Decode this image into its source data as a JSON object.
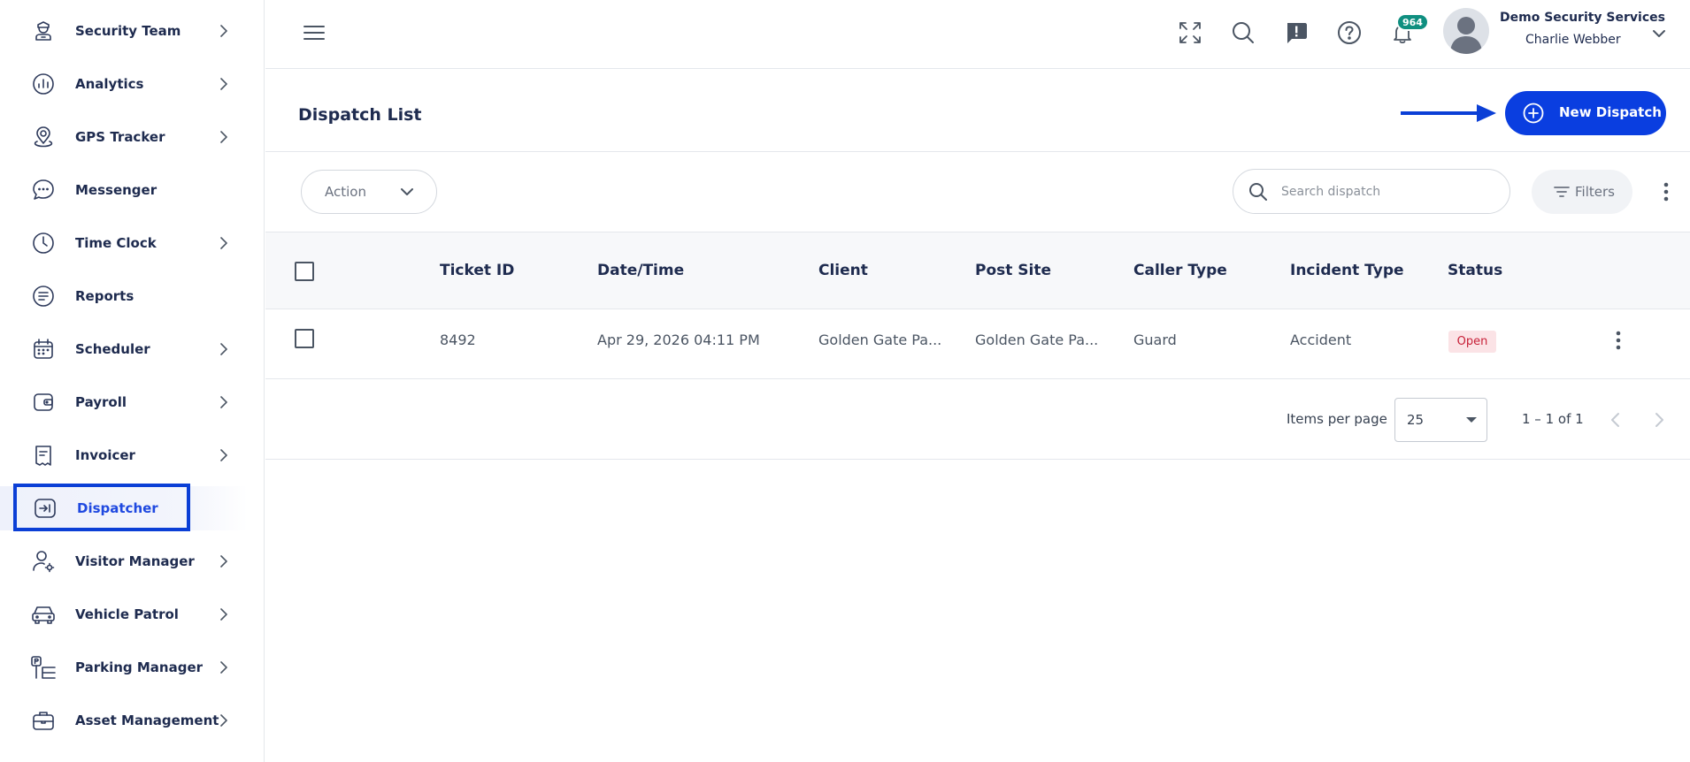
{
  "sidebar": {
    "items": [
      {
        "label": "Security Team",
        "icon": "guard-icon",
        "has_children": true
      },
      {
        "label": "Analytics",
        "icon": "analytics-icon",
        "has_children": true
      },
      {
        "label": "GPS Tracker",
        "icon": "map-pin-icon",
        "has_children": true
      },
      {
        "label": "Messenger",
        "icon": "chat-icon",
        "has_children": false
      },
      {
        "label": "Time Clock",
        "icon": "clock-icon",
        "has_children": true
      },
      {
        "label": "Reports",
        "icon": "report-icon",
        "has_children": false
      },
      {
        "label": "Scheduler",
        "icon": "calendar-icon",
        "has_children": true
      },
      {
        "label": "Payroll",
        "icon": "wallet-icon",
        "has_children": true
      },
      {
        "label": "Invoicer",
        "icon": "invoice-icon",
        "has_children": true
      },
      {
        "label": "Dispatcher",
        "icon": "dispatch-icon",
        "has_children": false,
        "active": true
      },
      {
        "label": "Visitor Manager",
        "icon": "visitor-icon",
        "has_children": true
      },
      {
        "label": "Vehicle Patrol",
        "icon": "car-icon",
        "has_children": true
      },
      {
        "label": "Parking Manager",
        "icon": "parking-icon",
        "has_children": true
      },
      {
        "label": "Asset Management",
        "icon": "briefcase-icon",
        "has_children": true
      }
    ]
  },
  "topbar": {
    "notification_count": "964",
    "org_name": "Demo Security Services",
    "user_name": "Charlie Webber"
  },
  "page": {
    "title": "Dispatch List",
    "new_button": "New Dispatch"
  },
  "toolbar": {
    "action_label": "Action",
    "search_placeholder": "Search dispatch",
    "filters_label": "Filters"
  },
  "table": {
    "columns": [
      "Ticket ID",
      "Date/Time",
      "Client",
      "Post Site",
      "Caller Type",
      "Incident Type",
      "Status"
    ],
    "rows": [
      {
        "ticket_id": "8492",
        "date_time": "Apr 29, 2026 04:11 PM",
        "client": "Golden Gate Pa...",
        "post_site": "Golden Gate Pa...",
        "caller_type": "Guard",
        "incident_type": "Accident",
        "status": "Open"
      }
    ]
  },
  "pagination": {
    "items_per_page_label": "Items per page",
    "items_per_page": "25",
    "range": "1 – 1 of 1"
  },
  "colors": {
    "primary": "#0a3ee0",
    "highlight_outline": "#0b3fd6",
    "badge": "#0f8f80",
    "status_open_bg": "#fbe3e6",
    "status_open_text": "#c71f37"
  }
}
